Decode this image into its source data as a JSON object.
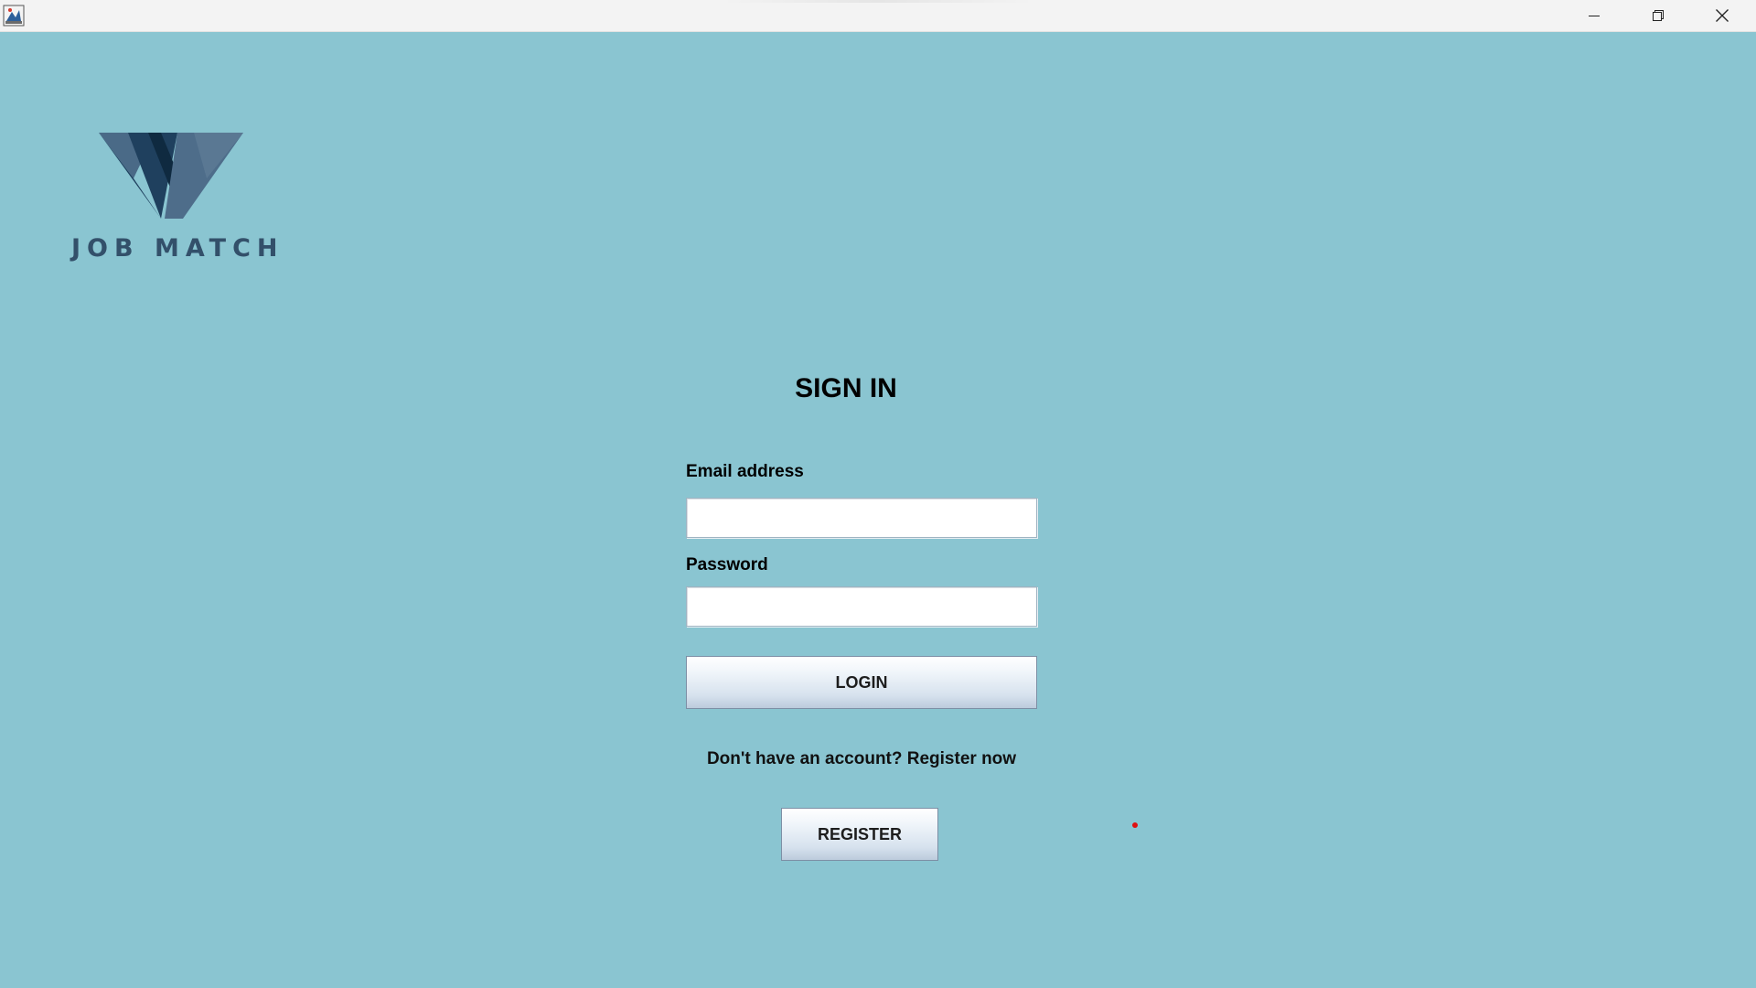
{
  "window": {
    "app_icon": "java-app-icon",
    "controls": {
      "minimize": "minimize-icon",
      "maximize": "restore-icon",
      "close": "close-icon"
    }
  },
  "logo": {
    "text": "JOB MATCH",
    "colors": {
      "dark": "#1e3e5a",
      "light": "#4b6a86",
      "accent": "#0f2a40"
    }
  },
  "form": {
    "title": "SIGN IN",
    "email_label": "Email address",
    "email_value": "",
    "password_label": "Password",
    "password_value": "",
    "login_label": "LOGIN",
    "register_hint": "Don't have an account? Register now",
    "register_label": "REGISTER"
  },
  "colors": {
    "background": "#8ac5d1",
    "titlebar": "#f3f3f3"
  }
}
